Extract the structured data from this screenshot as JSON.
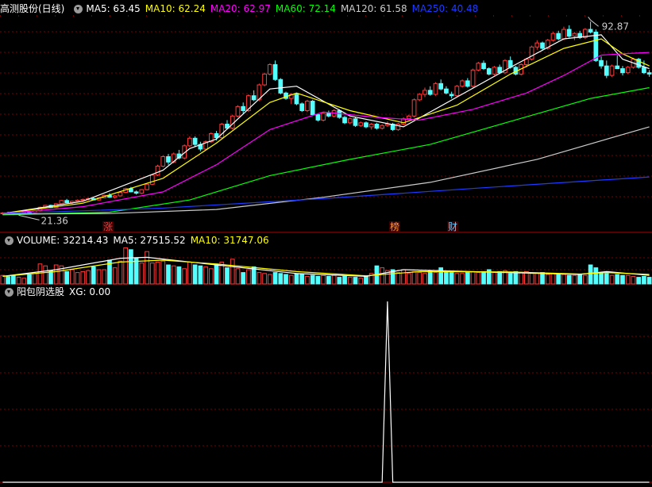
{
  "price_panel": {
    "title": "高测股份(日线)",
    "ma_labels": [
      {
        "text": "MA5: 63.45",
        "color": "#ffffff"
      },
      {
        "text": "MA10: 62.24",
        "color": "#ffff00"
      },
      {
        "text": "MA20: 62.97",
        "color": "#ff00ff"
      },
      {
        "text": "MA60: 72.14",
        "color": "#00ff00"
      },
      {
        "text": "MA120: 61.58",
        "color": "#cccccc"
      },
      {
        "text": "MA250: 40.48",
        "color": "#1e3cff"
      }
    ],
    "high_marker": "92.87",
    "low_marker": "21.36",
    "event_markers": [
      {
        "text": "涨",
        "color": "#ff3333"
      },
      {
        "text": "榜",
        "color": "#ff9933"
      },
      {
        "text": "财",
        "color": "#66ccff"
      }
    ]
  },
  "volume_panel": {
    "labels": [
      {
        "text": "VOLUME: 32214.43",
        "color": "#ffffff"
      },
      {
        "text": "MA5: 27515.52",
        "color": "#ffffff"
      },
      {
        "text": "MA10: 31747.06",
        "color": "#ffff00"
      }
    ]
  },
  "indicator_panel": {
    "title": "阳包阴选股",
    "labels": [
      {
        "text": "XG: 0.00",
        "color": "#ffffff"
      }
    ]
  },
  "colors": {
    "up": "#ff3b3b",
    "down": "#54ffff",
    "grid": "#7a0000",
    "axis": "#b00000",
    "ma5": "#ffffff",
    "ma10": "#ffff00",
    "ma20": "#ff00ff",
    "ma60": "#00ff00",
    "ma120": "#cccccc",
    "ma250": "#1e3cff"
  },
  "chart_data": {
    "type": "candlestick",
    "ylim": [
      20,
      95
    ],
    "candles": [
      [
        22.0,
        22.5,
        21.5,
        22.2
      ],
      [
        22.2,
        22.6,
        21.8,
        22.0
      ],
      [
        22.0,
        22.4,
        21.4,
        21.8
      ],
      [
        21.8,
        22.3,
        21.36,
        22.1
      ],
      [
        22.1,
        22.8,
        21.9,
        22.5
      ],
      [
        22.5,
        22.9,
        22.0,
        22.3
      ],
      [
        22.3,
        23.2,
        22.1,
        23.0
      ],
      [
        23.0,
        24.5,
        22.8,
        24.3
      ],
      [
        24.3,
        25.2,
        23.9,
        25.0
      ],
      [
        25.0,
        25.3,
        24.0,
        24.2
      ],
      [
        24.2,
        25.8,
        24.0,
        25.6
      ],
      [
        25.6,
        27.0,
        25.3,
        26.8
      ],
      [
        26.8,
        27.4,
        25.8,
        26.0
      ],
      [
        26.0,
        26.8,
        25.5,
        26.5
      ],
      [
        26.5,
        27.2,
        26.0,
        26.9
      ],
      [
        26.9,
        27.5,
        26.3,
        27.2
      ],
      [
        27.2,
        27.9,
        26.8,
        27.5
      ],
      [
        27.5,
        28.2,
        27.0,
        27.0
      ],
      [
        27.0,
        28.0,
        26.8,
        27.8
      ],
      [
        27.8,
        29.0,
        27.6,
        28.7
      ],
      [
        28.7,
        29.5,
        27.8,
        28.0
      ],
      [
        28.0,
        28.8,
        27.5,
        28.5
      ],
      [
        28.5,
        30.0,
        28.3,
        29.8
      ],
      [
        29.8,
        31.5,
        29.5,
        31.2
      ],
      [
        31.2,
        31.8,
        29.8,
        30.0
      ],
      [
        30.0,
        30.5,
        29.0,
        29.5
      ],
      [
        29.5,
        31.0,
        29.2,
        30.8
      ],
      [
        30.8,
        33.0,
        30.5,
        32.8
      ],
      [
        32.8,
        36.5,
        32.5,
        36.2
      ],
      [
        36.2,
        40.0,
        35.8,
        39.5
      ],
      [
        39.5,
        43.5,
        39.0,
        43.0
      ],
      [
        43.0,
        44.0,
        40.0,
        41.0
      ],
      [
        41.0,
        44.5,
        40.5,
        44.0
      ],
      [
        44.0,
        45.5,
        42.0,
        42.5
      ],
      [
        42.5,
        47.5,
        42.0,
        47.0
      ],
      [
        47.0,
        50.5,
        46.5,
        49.8
      ],
      [
        49.8,
        50.5,
        46.5,
        47.5
      ],
      [
        47.5,
        48.5,
        45.0,
        45.8
      ],
      [
        45.8,
        49.0,
        45.5,
        48.5
      ],
      [
        48.5,
        52.0,
        48.0,
        51.5
      ],
      [
        51.5,
        52.5,
        49.0,
        50.0
      ],
      [
        50.0,
        55.5,
        49.5,
        55.0
      ],
      [
        55.0,
        56.5,
        53.0,
        53.5
      ],
      [
        53.5,
        58.5,
        53.0,
        58.0
      ],
      [
        58.0,
        62.0,
        57.5,
        61.5
      ],
      [
        61.5,
        63.0,
        59.0,
        60.0
      ],
      [
        60.0,
        66.0,
        59.5,
        65.5
      ],
      [
        65.5,
        67.5,
        63.5,
        64.0
      ],
      [
        64.0,
        70.0,
        63.5,
        69.5
      ],
      [
        69.5,
        74.0,
        69.0,
        73.5
      ],
      [
        73.5,
        77.5,
        73.0,
        77.0
      ],
      [
        77.0,
        78.5,
        71.0,
        71.5
      ],
      [
        71.5,
        72.0,
        66.0,
        66.5
      ],
      [
        66.5,
        67.0,
        64.0,
        64.5
      ],
      [
        64.5,
        66.5,
        62.5,
        66.0
      ],
      [
        66.0,
        66.5,
        62.0,
        62.5
      ],
      [
        62.5,
        63.0,
        59.5,
        60.0
      ],
      [
        60.0,
        64.0,
        59.5,
        63.5
      ],
      [
        63.5,
        64.0,
        58.0,
        58.5
      ],
      [
        58.5,
        59.0,
        56.0,
        56.5
      ],
      [
        56.5,
        59.5,
        56.0,
        59.0
      ],
      [
        59.0,
        60.0,
        57.5,
        58.0
      ],
      [
        58.0,
        60.5,
        57.5,
        60.0
      ],
      [
        60.0,
        60.5,
        57.0,
        57.5
      ],
      [
        57.5,
        58.0,
        55.0,
        55.5
      ],
      [
        55.5,
        57.5,
        55.0,
        57.0
      ],
      [
        57.0,
        57.5,
        54.0,
        54.5
      ],
      [
        54.5,
        56.0,
        54.0,
        55.5
      ],
      [
        55.5,
        56.0,
        53.5,
        54.0
      ],
      [
        54.0,
        55.5,
        53.0,
        55.0
      ],
      [
        55.0,
        55.5,
        53.0,
        53.5
      ],
      [
        53.5,
        55.0,
        53.0,
        54.5
      ],
      [
        54.5,
        56.0,
        54.0,
        55.0
      ],
      [
        55.0,
        55.5,
        52.5,
        53.0
      ],
      [
        53.0,
        55.5,
        52.5,
        55.0
      ],
      [
        55.0,
        57.5,
        54.5,
        57.0
      ],
      [
        57.0,
        58.5,
        56.5,
        58.0
      ],
      [
        58.0,
        64.5,
        57.5,
        64.0
      ],
      [
        64.0,
        66.5,
        63.5,
        66.0
      ],
      [
        66.0,
        68.5,
        65.0,
        67.5
      ],
      [
        67.5,
        69.0,
        65.5,
        66.0
      ],
      [
        66.0,
        70.5,
        65.5,
        70.0
      ],
      [
        70.0,
        71.5,
        67.5,
        68.0
      ],
      [
        68.0,
        69.0,
        66.0,
        66.5
      ],
      [
        66.0,
        67.0,
        64.5,
        65.5
      ],
      [
        65.5,
        69.5,
        65.0,
        69.0
      ],
      [
        69.0,
        71.5,
        68.5,
        71.0
      ],
      [
        71.0,
        72.0,
        68.5,
        69.0
      ],
      [
        69.0,
        75.5,
        68.5,
        75.0
      ],
      [
        75.0,
        78.0,
        74.5,
        77.5
      ],
      [
        77.5,
        78.5,
        75.0,
        75.5
      ],
      [
        75.5,
        76.0,
        73.0,
        73.5
      ],
      [
        73.5,
        76.5,
        73.0,
        76.0
      ],
      [
        76.0,
        77.0,
        73.5,
        74.0
      ],
      [
        74.0,
        79.0,
        73.5,
        78.5
      ],
      [
        78.5,
        80.0,
        75.5,
        76.0
      ],
      [
        76.0,
        76.5,
        73.0,
        73.5
      ],
      [
        73.5,
        77.5,
        73.0,
        77.0
      ],
      [
        77.0,
        79.5,
        76.0,
        79.0
      ],
      [
        79.0,
        84.0,
        78.5,
        83.5
      ],
      [
        83.5,
        86.0,
        82.5,
        85.0
      ],
      [
        85.0,
        85.5,
        82.5,
        83.0
      ],
      [
        83.0,
        86.5,
        82.5,
        86.0
      ],
      [
        86.0,
        89.0,
        85.5,
        88.5
      ],
      [
        88.5,
        89.5,
        86.0,
        86.5
      ],
      [
        86.5,
        91.0,
        86.0,
        90.0
      ],
      [
        90.0,
        91.5,
        87.0,
        87.5
      ],
      [
        87.5,
        89.0,
        86.0,
        88.5
      ],
      [
        88.5,
        89.5,
        86.5,
        87.0
      ],
      [
        87.0,
        90.5,
        86.5,
        90.0
      ],
      [
        90.0,
        92.87,
        88.5,
        89.0
      ],
      [
        89.0,
        90.0,
        78.0,
        78.5
      ],
      [
        78.5,
        80.0,
        75.5,
        76.5
      ],
      [
        76.5,
        78.5,
        72.0,
        73.0
      ],
      [
        73.0,
        77.0,
        72.5,
        76.5
      ],
      [
        76.5,
        80.5,
        75.5,
        75.5
      ],
      [
        75.5,
        76.5,
        73.0,
        74.0
      ],
      [
        74.0,
        76.5,
        73.5,
        76.0
      ],
      [
        76.0,
        79.5,
        75.5,
        79.0
      ],
      [
        79.0,
        79.5,
        75.5,
        76.0
      ],
      [
        76.0,
        78.5,
        73.5,
        74.0
      ],
      [
        74.0,
        75.0,
        72.5,
        73.5
      ]
    ],
    "ma_series": [
      {
        "name": "MA5",
        "values": [
          [
            0,
            22.0
          ],
          [
            15,
            26.5
          ],
          [
            30,
            38.0
          ],
          [
            35,
            46.0
          ],
          [
            40,
            49.5
          ],
          [
            50,
            68.0
          ],
          [
            55,
            69.0
          ],
          [
            65,
            58.0
          ],
          [
            75,
            54.0
          ],
          [
            85,
            65.0
          ],
          [
            95,
            76.0
          ],
          [
            105,
            86.5
          ],
          [
            112,
            88.0
          ],
          [
            116,
            79.0
          ],
          [
            121,
            75.5
          ]
        ]
      },
      {
        "name": "MA10",
        "values": [
          [
            0,
            22.0
          ],
          [
            15,
            25.8
          ],
          [
            30,
            35.0
          ],
          [
            40,
            48.0
          ],
          [
            50,
            63.0
          ],
          [
            55,
            66.5
          ],
          [
            65,
            60.0
          ],
          [
            75,
            55.5
          ],
          [
            85,
            62.0
          ],
          [
            95,
            73.5
          ],
          [
            105,
            83.0
          ],
          [
            112,
            86.5
          ],
          [
            116,
            81.0
          ],
          [
            121,
            76.5
          ]
        ]
      },
      {
        "name": "MA20",
        "values": [
          [
            0,
            22.0
          ],
          [
            15,
            24.5
          ],
          [
            30,
            30.0
          ],
          [
            40,
            40.0
          ],
          [
            50,
            53.0
          ],
          [
            60,
            59.5
          ],
          [
            70,
            57.5
          ],
          [
            78,
            56.5
          ],
          [
            88,
            60.5
          ],
          [
            98,
            66.5
          ],
          [
            105,
            73.0
          ],
          [
            112,
            80.5
          ],
          [
            116,
            81.0
          ],
          [
            121,
            81.5
          ]
        ]
      },
      {
        "name": "MA60",
        "values": [
          [
            0,
            21.5
          ],
          [
            20,
            22.5
          ],
          [
            35,
            27.0
          ],
          [
            50,
            36.0
          ],
          [
            65,
            42.0
          ],
          [
            80,
            47.5
          ],
          [
            95,
            56.0
          ],
          [
            110,
            64.5
          ],
          [
            121,
            68.5
          ]
        ]
      },
      {
        "name": "MA120",
        "values": [
          [
            0,
            21.8
          ],
          [
            20,
            22.0
          ],
          [
            40,
            23.5
          ],
          [
            60,
            28.0
          ],
          [
            80,
            33.5
          ],
          [
            100,
            42.0
          ],
          [
            121,
            54.0
          ]
        ]
      },
      {
        "name": "MA250",
        "values": [
          [
            0,
            22.0
          ],
          [
            30,
            24.0
          ],
          [
            60,
            27.5
          ],
          [
            90,
            31.5
          ],
          [
            121,
            35.5
          ]
        ]
      }
    ],
    "volume": [
      4.5,
      3.8,
      4.2,
      3.5,
      3.0,
      4.8,
      5.5,
      10.5,
      9.5,
      7.0,
      10.0,
      9.5,
      6.5,
      7.5,
      6.0,
      6.5,
      7.0,
      9.0,
      7.5,
      7.5,
      12.5,
      8.5,
      12.0,
      19.0,
      18.0,
      13.5,
      11.0,
      17.0,
      11.0,
      11.5,
      12.0,
      10.0,
      9.5,
      9.0,
      8.0,
      11.5,
      10.0,
      9.5,
      9.0,
      8.0,
      10.5,
      11.5,
      8.5,
      13.0,
      8.0,
      6.0,
      7.5,
      9.0,
      6.0,
      5.5,
      5.0,
      6.0,
      5.5,
      5.0,
      4.5,
      5.5,
      5.0,
      4.0,
      4.5,
      4.0,
      4.5,
      4.0,
      4.5,
      3.5,
      4.0,
      3.5,
      3.5,
      3.0,
      4.0,
      5.5,
      9.5,
      8.5,
      7.0,
      7.5,
      6.0,
      7.5,
      5.5,
      6.5,
      6.0,
      5.5,
      7.0,
      6.0,
      8.5,
      6.5,
      6.0,
      5.5,
      5.5,
      6.0,
      6.5,
      6.0,
      6.5,
      7.5,
      6.0,
      6.5,
      7.0,
      5.5,
      6.5,
      6.0,
      6.5,
      5.5,
      5.5,
      6.0,
      5.0,
      5.5,
      5.0,
      5.0,
      4.5,
      4.5,
      5.0,
      4.5,
      10.0,
      8.5,
      6.0,
      5.5,
      4.5,
      5.0,
      4.5,
      4.5,
      4.0,
      3.5,
      4.0,
      3.5
    ],
    "volume_ylim": [
      0,
      20
    ],
    "volume_ma": [
      {
        "name": "MA5",
        "values": [
          [
            0,
            4.0
          ],
          [
            10,
            7.5
          ],
          [
            22,
            13.5
          ],
          [
            27,
            14.0
          ],
          [
            40,
            10.0
          ],
          [
            55,
            5.5
          ],
          [
            68,
            4.0
          ],
          [
            75,
            7.5
          ],
          [
            90,
            6.3
          ],
          [
            108,
            5.0
          ],
          [
            113,
            6.5
          ],
          [
            121,
            4.5
          ]
        ]
      },
      {
        "name": "MA10",
        "values": [
          [
            0,
            4.0
          ],
          [
            10,
            6.5
          ],
          [
            22,
            11.5
          ],
          [
            30,
            12.5
          ],
          [
            40,
            10.5
          ],
          [
            55,
            6.5
          ],
          [
            68,
            4.3
          ],
          [
            78,
            6.5
          ],
          [
            95,
            6.3
          ],
          [
            108,
            5.2
          ],
          [
            113,
            6.0
          ],
          [
            121,
            5.0
          ]
        ]
      }
    ],
    "indicator": {
      "series": "XG",
      "ylim": [
        0,
        1
      ],
      "values": [
        0,
        0,
        0,
        0,
        0,
        0,
        0,
        0,
        0,
        0,
        0,
        0,
        0,
        0,
        0,
        0,
        0,
        0,
        0,
        0,
        0,
        0,
        0,
        0,
        0,
        0,
        0,
        0,
        0,
        0,
        0,
        0,
        0,
        0,
        0,
        0,
        0,
        0,
        0,
        0,
        0,
        0,
        0,
        0,
        0,
        0,
        0,
        0,
        0,
        0,
        0,
        0,
        0,
        0,
        0,
        0,
        0,
        0,
        0,
        0,
        0,
        0,
        0,
        0,
        0,
        0,
        0,
        0,
        0,
        0,
        0,
        0,
        1,
        0,
        0,
        0,
        0,
        0,
        0,
        0,
        0,
        0,
        0,
        0,
        0,
        0,
        0,
        0,
        0,
        0,
        0,
        0,
        0,
        0,
        0,
        0,
        0,
        0,
        0,
        0,
        0,
        0,
        0,
        0,
        0,
        0,
        0,
        0,
        0,
        0,
        0,
        0,
        0,
        0,
        0,
        0,
        0,
        0,
        0,
        0,
        0,
        0
      ]
    }
  }
}
